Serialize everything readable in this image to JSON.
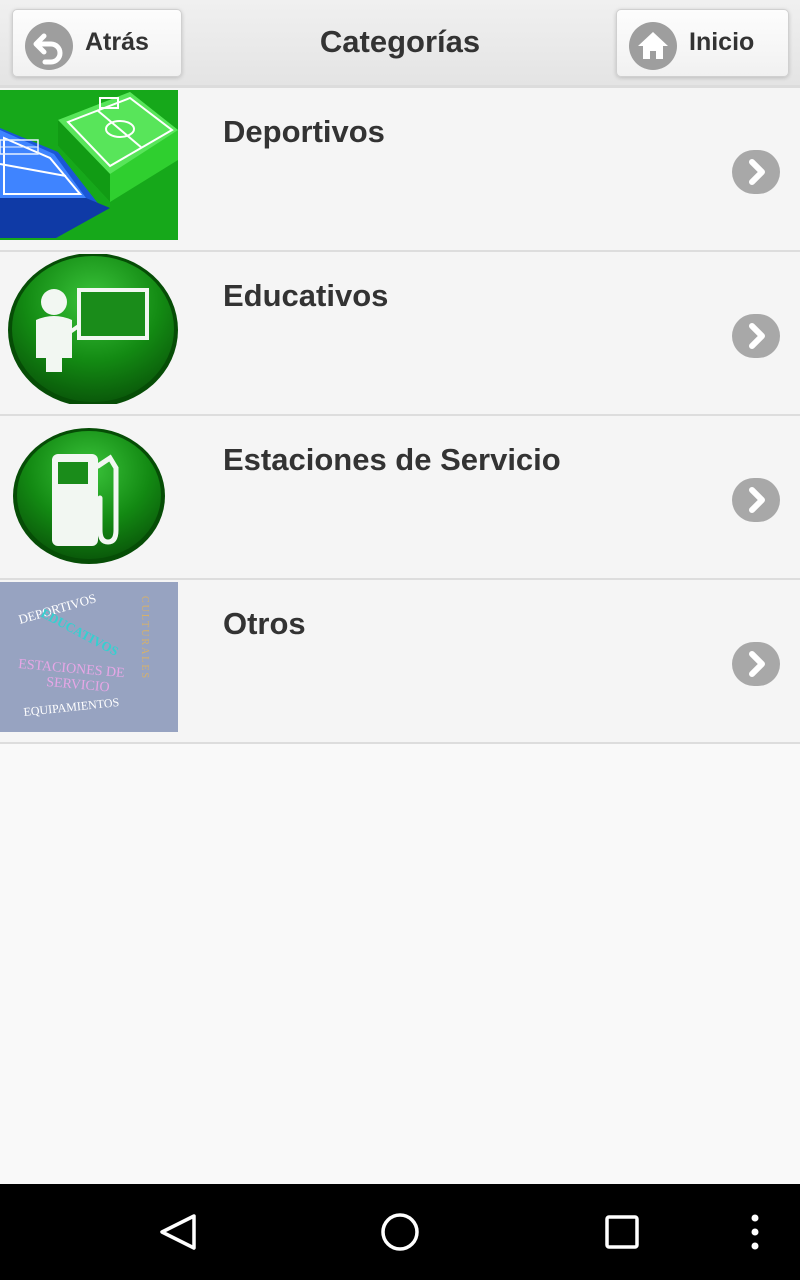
{
  "header": {
    "title": "Categorías",
    "back_label": "Atrás",
    "home_label": "Inicio"
  },
  "categories": [
    {
      "label": "Deportivos",
      "icon": "sports-field-icon"
    },
    {
      "label": "Educativos",
      "icon": "teacher-board-icon"
    },
    {
      "label": "Estaciones de Servicio",
      "icon": "fuel-pump-icon"
    },
    {
      "label": "Otros",
      "icon": "word-collage-icon",
      "collage_words": {
        "w1": "DEPORTIVOS",
        "w2": "EDUCATIVOS",
        "w3": "ESTACIONES DE",
        "w4": "SERVICIO",
        "w5": "EQUIPAMIENTOS",
        "w6": "CULTURALES"
      }
    }
  ],
  "colors": {
    "header_bg": "#e8e8e8",
    "list_bg": "#f5f5f5",
    "icon_green": "#138a13",
    "chevron_grey": "#a8a8a8",
    "nav_bar": "#000000"
  },
  "navbar": {
    "icons": [
      "back-triangle-icon",
      "home-circle-icon",
      "recents-square-icon",
      "overflow-dots-icon"
    ]
  }
}
